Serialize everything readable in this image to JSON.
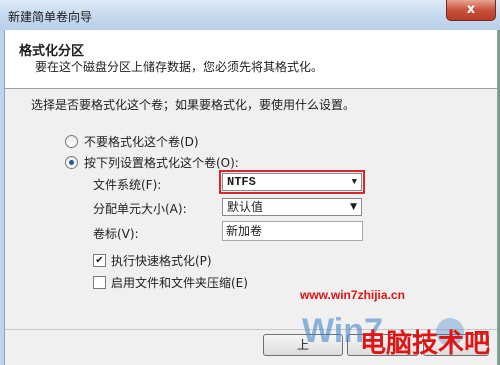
{
  "window": {
    "title": "新建简单卷向导",
    "close_label": "x"
  },
  "header": {
    "title": "格式化分区",
    "subtitle": "要在这个磁盘分区上储存数据，您必须先将其格式化。"
  },
  "question": "选择是否要格式化这个卷；如果要格式化，要使用什么设置。",
  "options": {
    "no_format": {
      "label": "不要格式化这个卷(D)",
      "selected": false
    },
    "format": {
      "label": "按下列设置格式化这个卷(O):",
      "selected": true
    }
  },
  "settings": {
    "file_system": {
      "label": "文件系统(F):",
      "value": "NTFS"
    },
    "allocation_unit": {
      "label": "分配单元大小(A):",
      "value": "默认值"
    },
    "volume_label": {
      "label": "卷标(V):",
      "value": "新加卷"
    }
  },
  "checks": {
    "quick_format": {
      "label": "执行快速格式化(P)",
      "checked": true
    },
    "compression": {
      "label": "启用文件和文件夹压缩(E)",
      "checked": false
    }
  },
  "buttons": {
    "back_label": "上"
  },
  "watermark": {
    "url": "www.win7zhijia.cn",
    "brand": "电脑技术吧"
  },
  "colors": {
    "highlight": "#d8262d",
    "watermark": "#e01414"
  }
}
